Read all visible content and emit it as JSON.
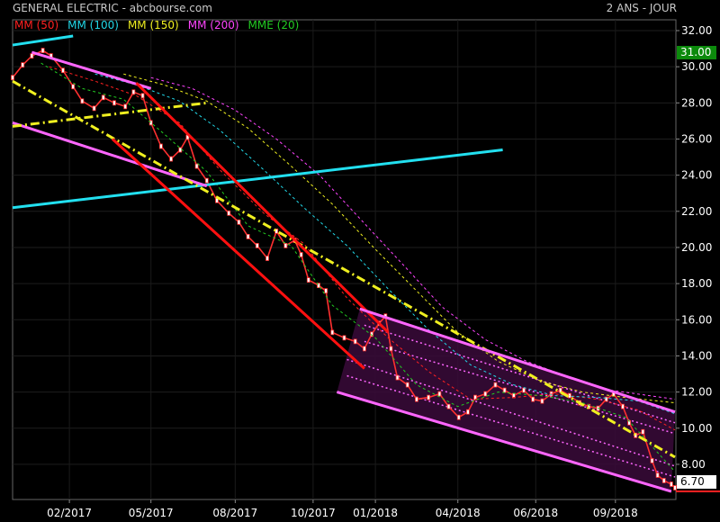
{
  "header": {
    "title": "GENERAL ELECTRIC - abcbourse.com",
    "period": "2 ANS - JOUR"
  },
  "legend": [
    {
      "label": "MM (50)",
      "color": "#ff2020"
    },
    {
      "label": "MM (100)",
      "color": "#22d8e8"
    },
    {
      "label": "MM (150)",
      "color": "#f0f020"
    },
    {
      "label": "MM (200)",
      "color": "#ff44ff"
    },
    {
      "label": "MME (20)",
      "color": "#22cc22"
    }
  ],
  "badges": {
    "high": "31.00",
    "last": "6.70"
  },
  "chart_data": {
    "type": "line",
    "ylim": [
      6,
      33
    ],
    "yticks": [
      "32.00",
      "30.00",
      "28.00",
      "26.00",
      "24.00",
      "22.00",
      "20.00",
      "18.00",
      "16.00",
      "14.00",
      "12.00",
      "10.00",
      "8.00"
    ],
    "xlim": [
      "2016-12-01",
      "2018-11-25"
    ],
    "xticks": [
      {
        "date": "2017-02-01",
        "label": "02/2017"
      },
      {
        "date": "2017-05-01",
        "label": "05/2017"
      },
      {
        "date": "2017-08-01",
        "label": "08/2017"
      },
      {
        "date": "2017-10-25",
        "label": "10/2017"
      },
      {
        "date": "2018-01-01",
        "label": "01/2018"
      },
      {
        "date": "2018-04-01",
        "label": "04/2018"
      },
      {
        "date": "2018-06-25",
        "label": "06/2018"
      },
      {
        "date": "2018-09-20",
        "label": "09/2018"
      }
    ],
    "grid": true,
    "legend_position": "top-left",
    "series": [
      {
        "name": "Close",
        "color": "#ff3030",
        "points": [
          [
            "2016-12-01",
            29.4
          ],
          [
            "2016-12-12",
            30.1
          ],
          [
            "2016-12-22",
            30.6
          ],
          [
            "2017-01-03",
            30.9
          ],
          [
            "2017-01-12",
            30.6
          ],
          [
            "2017-01-25",
            29.8
          ],
          [
            "2017-02-05",
            28.9
          ],
          [
            "2017-02-15",
            28.1
          ],
          [
            "2017-02-28",
            27.7
          ],
          [
            "2017-03-10",
            28.3
          ],
          [
            "2017-03-22",
            28.0
          ],
          [
            "2017-04-03",
            27.8
          ],
          [
            "2017-04-12",
            28.6
          ],
          [
            "2017-04-22",
            28.4
          ],
          [
            "2017-05-01",
            26.9
          ],
          [
            "2017-05-12",
            25.6
          ],
          [
            "2017-05-23",
            24.9
          ],
          [
            "2017-06-02",
            25.4
          ],
          [
            "2017-06-10",
            26.1
          ],
          [
            "2017-06-20",
            24.5
          ],
          [
            "2017-07-01",
            23.7
          ],
          [
            "2017-07-12",
            22.6
          ],
          [
            "2017-07-25",
            21.9
          ],
          [
            "2017-08-05",
            21.4
          ],
          [
            "2017-08-15",
            20.6
          ],
          [
            "2017-08-25",
            20.1
          ],
          [
            "2017-09-05",
            19.4
          ],
          [
            "2017-09-15",
            20.9
          ],
          [
            "2017-09-25",
            20.1
          ],
          [
            "2017-10-05",
            20.4
          ],
          [
            "2017-10-12",
            19.6
          ],
          [
            "2017-10-20",
            18.2
          ],
          [
            "2017-10-31",
            17.9
          ],
          [
            "2017-11-08",
            17.6
          ],
          [
            "2017-11-15",
            15.3
          ],
          [
            "2017-11-28",
            15.0
          ],
          [
            "2017-12-10",
            14.8
          ],
          [
            "2017-12-20",
            14.4
          ],
          [
            "2017-12-28",
            15.2
          ],
          [
            "2018-01-05",
            15.8
          ],
          [
            "2018-01-12",
            16.2
          ],
          [
            "2018-01-18",
            14.4
          ],
          [
            "2018-01-25",
            12.8
          ],
          [
            "2018-02-05",
            12.4
          ],
          [
            "2018-02-15",
            11.6
          ],
          [
            "2018-02-28",
            11.7
          ],
          [
            "2018-03-12",
            11.9
          ],
          [
            "2018-03-22",
            11.2
          ],
          [
            "2018-04-02",
            10.6
          ],
          [
            "2018-04-12",
            10.9
          ],
          [
            "2018-04-20",
            11.7
          ],
          [
            "2018-05-01",
            11.9
          ],
          [
            "2018-05-12",
            12.4
          ],
          [
            "2018-05-22",
            12.1
          ],
          [
            "2018-06-01",
            11.8
          ],
          [
            "2018-06-12",
            12.1
          ],
          [
            "2018-06-22",
            11.6
          ],
          [
            "2018-07-02",
            11.5
          ],
          [
            "2018-07-12",
            11.9
          ],
          [
            "2018-07-22",
            12.1
          ],
          [
            "2018-08-01",
            11.8
          ],
          [
            "2018-08-12",
            11.4
          ],
          [
            "2018-08-22",
            11.2
          ],
          [
            "2018-09-01",
            11.1
          ],
          [
            "2018-09-10",
            11.6
          ],
          [
            "2018-09-18",
            11.9
          ],
          [
            "2018-09-28",
            11.2
          ],
          [
            "2018-10-05",
            10.3
          ],
          [
            "2018-10-12",
            9.6
          ],
          [
            "2018-10-20",
            9.8
          ],
          [
            "2018-10-30",
            8.2
          ],
          [
            "2018-11-05",
            7.4
          ],
          [
            "2018-11-12",
            7.1
          ],
          [
            "2018-11-20",
            6.9
          ],
          [
            "2018-11-24",
            6.7
          ]
        ]
      },
      {
        "name": "MM (50)",
        "color": "#ff2020",
        "dash": "3,3",
        "points": [
          [
            "2017-01-10",
            30.0
          ],
          [
            "2017-03-01",
            29.2
          ],
          [
            "2017-04-15",
            28.4
          ],
          [
            "2017-06-01",
            26.9
          ],
          [
            "2017-07-15",
            24.3
          ],
          [
            "2017-09-01",
            21.9
          ],
          [
            "2017-10-15",
            20.2
          ],
          [
            "2017-12-01",
            17.2
          ],
          [
            "2018-01-15",
            15.0
          ],
          [
            "2018-03-01",
            13.1
          ],
          [
            "2018-04-15",
            11.6
          ],
          [
            "2018-06-01",
            11.7
          ],
          [
            "2018-07-15",
            11.9
          ],
          [
            "2018-09-01",
            11.6
          ],
          [
            "2018-10-15",
            11.0
          ],
          [
            "2018-11-24",
            9.9
          ]
        ]
      },
      {
        "name": "MM (100)",
        "color": "#22d8e8",
        "dash": "3,3",
        "points": [
          [
            "2017-03-01",
            29.6
          ],
          [
            "2017-04-15",
            29.0
          ],
          [
            "2017-06-01",
            28.1
          ],
          [
            "2017-07-15",
            26.5
          ],
          [
            "2017-09-01",
            24.3
          ],
          [
            "2017-10-15",
            22.2
          ],
          [
            "2017-12-01",
            20.1
          ],
          [
            "2018-01-15",
            17.7
          ],
          [
            "2018-03-01",
            15.4
          ],
          [
            "2018-04-15",
            13.5
          ],
          [
            "2018-06-01",
            12.4
          ],
          [
            "2018-07-15",
            11.8
          ],
          [
            "2018-09-01",
            11.7
          ],
          [
            "2018-10-15",
            11.5
          ],
          [
            "2018-11-24",
            10.8
          ]
        ]
      },
      {
        "name": "MM (150)",
        "color": "#f0f020",
        "dash": "3,3",
        "points": [
          [
            "2017-04-01",
            29.6
          ],
          [
            "2017-05-15",
            29.0
          ],
          [
            "2017-07-01",
            28.1
          ],
          [
            "2017-08-15",
            26.6
          ],
          [
            "2017-10-01",
            24.5
          ],
          [
            "2017-11-15",
            22.4
          ],
          [
            "2018-01-01",
            19.9
          ],
          [
            "2018-02-15",
            17.6
          ],
          [
            "2018-04-01",
            15.3
          ],
          [
            "2018-05-15",
            13.7
          ],
          [
            "2018-07-01",
            12.6
          ],
          [
            "2018-08-15",
            12.0
          ],
          [
            "2018-10-01",
            11.7
          ],
          [
            "2018-11-24",
            11.4
          ]
        ]
      },
      {
        "name": "MM (200)",
        "color": "#ff44ff",
        "dash": "3,3",
        "points": [
          [
            "2017-05-01",
            29.4
          ],
          [
            "2017-06-15",
            28.8
          ],
          [
            "2017-08-01",
            27.6
          ],
          [
            "2017-09-15",
            26.0
          ],
          [
            "2017-11-01",
            24.0
          ],
          [
            "2017-12-15",
            21.6
          ],
          [
            "2018-02-01",
            19.0
          ],
          [
            "2018-03-15",
            16.7
          ],
          [
            "2018-05-01",
            14.9
          ],
          [
            "2018-06-15",
            13.7
          ],
          [
            "2018-08-01",
            12.8
          ],
          [
            "2018-09-15",
            12.1
          ],
          [
            "2018-11-24",
            11.6
          ]
        ]
      },
      {
        "name": "MME (20)",
        "color": "#22cc22",
        "dash": "3,3",
        "points": [
          [
            "2017-01-01",
            30.2
          ],
          [
            "2017-02-15",
            28.8
          ],
          [
            "2017-04-01",
            28.2
          ],
          [
            "2017-05-15",
            26.3
          ],
          [
            "2017-07-01",
            24.2
          ],
          [
            "2017-08-15",
            21.2
          ],
          [
            "2017-10-01",
            20.1
          ],
          [
            "2017-11-15",
            16.8
          ],
          [
            "2018-01-01",
            15.0
          ],
          [
            "2018-02-15",
            12.4
          ],
          [
            "2018-04-01",
            11.2
          ],
          [
            "2018-05-15",
            12.0
          ],
          [
            "2018-07-01",
            11.8
          ],
          [
            "2018-08-15",
            11.4
          ],
          [
            "2018-10-01",
            10.6
          ],
          [
            "2018-11-24",
            7.6
          ]
        ]
      }
    ],
    "trendlines": [
      {
        "color": "#22e0f0",
        "width": 3,
        "from": [
          "2016-12-01",
          31.2
        ],
        "to": [
          "2017-02-05",
          31.7
        ]
      },
      {
        "color": "#22e0f0",
        "width": 3,
        "from": [
          "2016-12-01",
          22.2
        ],
        "to": [
          "2018-05-20",
          25.4
        ]
      },
      {
        "color": "#ff66ff",
        "width": 3,
        "from": [
          "2016-12-22",
          30.8
        ],
        "to": [
          "2017-05-01",
          28.8
        ]
      },
      {
        "color": "#ff66ff",
        "width": 3,
        "from": [
          "2016-12-01",
          26.9
        ],
        "to": [
          "2017-07-01",
          23.4
        ]
      },
      {
        "color": "#f0f020",
        "width": 3,
        "dash": "10,4,2,4",
        "from": [
          "2016-12-01",
          29.2
        ],
        "to": [
          "2018-11-24",
          8.4
        ]
      },
      {
        "color": "#f0f020",
        "width": 3,
        "dash": "10,4,2,4",
        "from": [
          "2016-12-01",
          26.7
        ],
        "to": [
          "2017-07-01",
          28.0
        ]
      },
      {
        "color": "#ff1010",
        "width": 3,
        "from": [
          "2017-04-15",
          29.1
        ],
        "to": [
          "2018-01-15",
          15.3
        ]
      },
      {
        "color": "#ff1010",
        "width": 3,
        "from": [
          "2017-03-20",
          26.0
        ],
        "to": [
          "2017-12-20",
          13.3
        ]
      },
      {
        "color": "#ff66ff",
        "width": 3,
        "from": [
          "2017-12-15",
          16.6
        ],
        "to": [
          "2018-11-24",
          10.9
        ]
      },
      {
        "color": "#ff66ff",
        "width": 3,
        "from": [
          "2017-11-20",
          12.0
        ],
        "to": [
          "2018-11-20",
          6.5
        ]
      }
    ],
    "channel": {
      "fill": "#3a0a3a",
      "line_color": "#ff66ff",
      "dash": "2,3",
      "upper": {
        "from": [
          "2017-12-15",
          16.6
        ],
        "to": [
          "2018-11-24",
          10.9
        ]
      },
      "lower": {
        "from": [
          "2017-11-20",
          12.0
        ],
        "to": [
          "2018-11-20",
          6.5
        ]
      },
      "inner": [
        {
          "from": [
            "2017-12-20",
            15.7
          ],
          "to": [
            "2018-11-24",
            10.3
          ]
        },
        {
          "from": [
            "2017-12-20",
            14.8
          ],
          "to": [
            "2018-11-24",
            9.7
          ]
        },
        {
          "from": [
            "2017-12-01",
            13.8
          ],
          "to": [
            "2018-11-24",
            7.9
          ]
        },
        {
          "from": [
            "2017-12-01",
            12.9
          ],
          "to": [
            "2018-11-24",
            7.3
          ]
        }
      ]
    }
  }
}
